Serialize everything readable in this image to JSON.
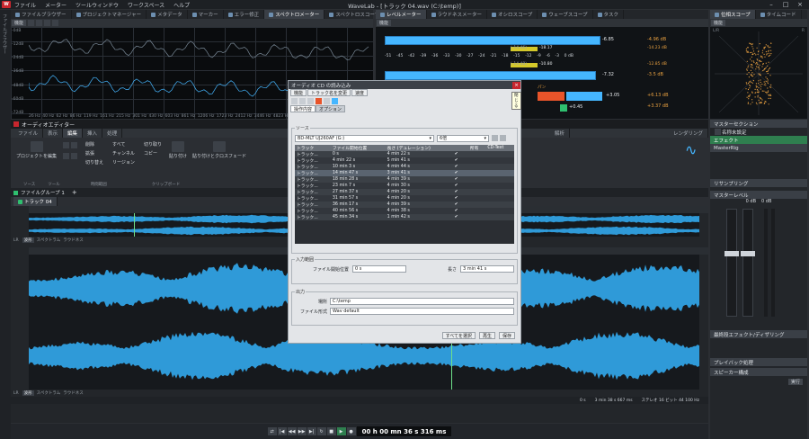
{
  "window": {
    "title": "WaveLab - [トラック 04.wav (C:\\temp)]"
  },
  "menu": [
    "ファイル",
    "メーター",
    "ツールウィンドウ",
    "ワークスペース",
    "ヘルプ"
  ],
  "top_tabs": [
    "ファイルブラウザー",
    "プロジェクトマネージャー",
    "メタデータ",
    "マーカー",
    "エラー修正",
    "スペクトロメーター",
    "スペクトロスコープ"
  ],
  "meter_tabs": [
    "レベルメーター",
    "ラウドネスメーター",
    "オシロスコープ",
    "ウェーブスコープ",
    "タスク"
  ],
  "phase_tabs": [
    "位相スコープ",
    "タイムコード"
  ],
  "features_label": "機能",
  "spectrum": {
    "y_axis": [
      "-0dB",
      "-12dB",
      "-24dB",
      "-36dB",
      "-48dB",
      "-60dB",
      "-72dB"
    ],
    "x_axis": [
      "26 Hz",
      "40 Hz",
      "62 Hz",
      "86 Hz",
      "119 Hz",
      "161 Hz",
      "215 Hz",
      "301 Hz",
      "430 Hz",
      "603 Hz",
      "861 Hz",
      "1206 Hz",
      "1723 Hz",
      "2412 Hz",
      "3446 Hz",
      "4823 Hz",
      "6890 Hz",
      "9646 Hz",
      "13781 Hz",
      "19293 Hz"
    ]
  },
  "level_meter": {
    "top": {
      "peak_label": "-6.85",
      "rms_left": "-18.17",
      "rms_right": "-10.80",
      "max_label": "-4.96 dB",
      "max2": "-14.23 dB",
      "max3": "-12.85 dB",
      "min": "-3.5 dB",
      "rms_l_val": "(-14.46)",
      "rms_r_val": "(-14.48)"
    },
    "scale": [
      "-51",
      "-45",
      "-42",
      "-39",
      "-36",
      "-33",
      "-30",
      "-27",
      "-24",
      "-21",
      "-18",
      "-15",
      "-12",
      "-9",
      "-6",
      "-3",
      "0 dB"
    ],
    "bottom": {
      "value1": "-7.32",
      "value2": "+3.05",
      "value3": "+0.45",
      "right1": "+6.13 dB",
      "right2": "+3.37 dB",
      "pan": "パン"
    }
  },
  "phase": {
    "label_top": "L/R",
    "label_right": "R"
  },
  "audio_editor": {
    "title": "オーディオエディター",
    "ribbon_tabs": [
      "ファイル",
      "表示",
      "編集",
      "挿入",
      "処理"
    ],
    "ribbon_tabs_right": [
      "解析",
      "レンダリング"
    ],
    "groups": [
      "ソース",
      "ツール",
      "時間範囲",
      "クリップボード"
    ],
    "buttons": {
      "edit_project": "プロジェクトを編集",
      "delete": "削除",
      "expand": "拡張",
      "cut_range": "切り替え",
      "all": "すべて",
      "channels": "チャンネル",
      "region": "リージョン",
      "cut": "切り取り",
      "copy": "コピー",
      "paste": "貼り付け",
      "paste_crossfade": "貼り付けとクロスフェード"
    },
    "file_group": "ファイルグループ 1",
    "track_tab": "トラック 04",
    "bottom_tabs": [
      "波形",
      "スペクトラム",
      "ラウドネス"
    ],
    "lr": "LR"
  },
  "dialog": {
    "title": "オーディオ CD の読み込み",
    "menu": [
      "機能",
      "トラック名を変更",
      "速度"
    ],
    "tabs": [
      "操作内容",
      "オプション"
    ],
    "source_label": "ソース",
    "drive": "BD-MLT UJ260AF (G:)",
    "speed": "6倍",
    "columns": [
      "トラック",
      "ファイル開始位置",
      "長さ (デュレーション)",
      "",
      "",
      "所有",
      "CD-Text"
    ],
    "tracks": [
      {
        "name": "トラック...",
        "start": "0 s",
        "length": "4 min 22 s"
      },
      {
        "name": "トラック...",
        "start": "4 min 22 s",
        "length": "5 min 41 s"
      },
      {
        "name": "トラック...",
        "start": "10 min 3 s",
        "length": "4 min 44 s"
      },
      {
        "name": "トラック...",
        "start": "14 min 47 s",
        "length": "3 min 41 s"
      },
      {
        "name": "トラック...",
        "start": "18 min 28 s",
        "length": "4 min 39 s"
      },
      {
        "name": "トラック...",
        "start": "23 min 7 s",
        "length": "4 min 30 s"
      },
      {
        "name": "トラック...",
        "start": "27 min 37 s",
        "length": "4 min 20 s"
      },
      {
        "name": "トラック...",
        "start": "31 min 57 s",
        "length": "4 min 20 s"
      },
      {
        "name": "トラック...",
        "start": "36 min 17 s",
        "length": "4 min 39 s"
      },
      {
        "name": "トラック...",
        "start": "40 min 56 s",
        "length": "4 min 38 s"
      },
      {
        "name": "トラック...",
        "start": "45 min 34 s",
        "length": "1 min 42 s"
      }
    ],
    "range_label": "入力範囲",
    "start_label": "ファイル開始位置",
    "start_value": "0 s",
    "length_label": "長さ",
    "length_value": "3 min 41 s",
    "output_label": "出力",
    "location_label": "場所",
    "location_value": "C:\\temp",
    "format_label": "ファイル形式",
    "format_value": "Wav default",
    "btn_select_all": "すべてを選択",
    "btn_play": "再生",
    "btn_save": "保存",
    "tooltip": "閉じる"
  },
  "master": {
    "title": "マスターセクション",
    "preset": "名称未設定",
    "effects": "エフェクト",
    "masterrig": "MasterRig",
    "resampling": "リサンプリング",
    "master_level": "マスターレベル",
    "level_l": "0 dB",
    "level_r": "0 dB",
    "final_effects": "最終段エフェクト/ディザリング",
    "playback": "プレイバック処理",
    "speaker": "スピーカー構成",
    "render": "実行"
  },
  "status": {
    "cursor": "0 s",
    "selection": "3 min 38 s 667 ms",
    "format": "ステレオ 16 ビット 44 100 Hz"
  },
  "transport": {
    "time": "00 h 00 mn 36 s 316 ms"
  },
  "sidebar_left": "ファイルブラウザー"
}
